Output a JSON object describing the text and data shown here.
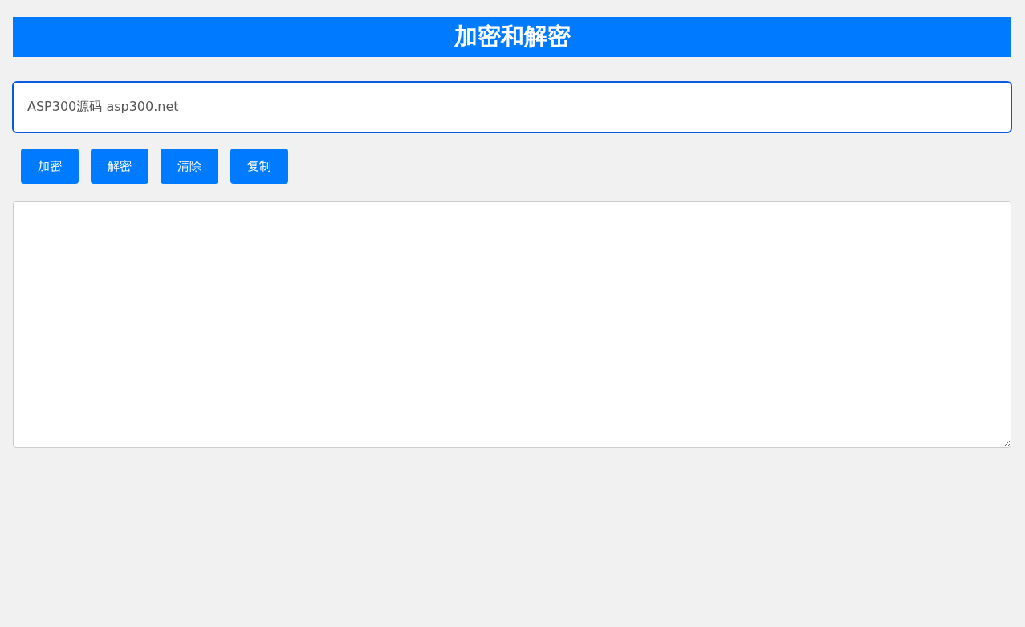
{
  "title": "加密和解密",
  "input": {
    "value": "ASP300源码 asp300.net",
    "focused": true
  },
  "buttons": [
    "加密",
    "解密",
    "清除",
    "复制"
  ]
}
